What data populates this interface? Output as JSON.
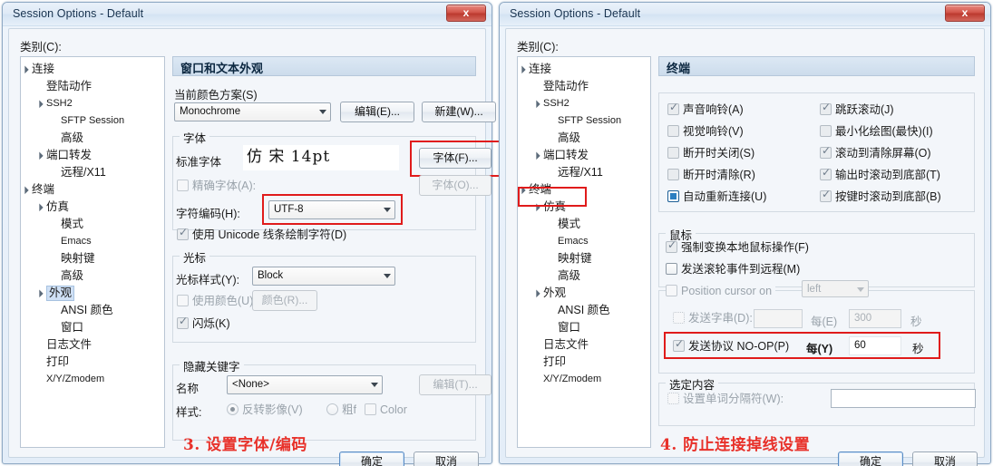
{
  "dialogs": {
    "left": {
      "title": "Session Options - Default",
      "close_label": "x",
      "category_label": "类别(C):",
      "pane_title": "窗口和文本外观",
      "tree": [
        {
          "label": "连接",
          "depth": 0,
          "arrow": "▲",
          "latin": false,
          "selected": false
        },
        {
          "label": "登陆动作",
          "depth": 1,
          "arrow": "",
          "latin": false,
          "selected": false
        },
        {
          "label": "SSH2",
          "depth": 1,
          "arrow": "▲",
          "latin": true,
          "selected": false
        },
        {
          "label": "SFTP Session",
          "depth": 2,
          "arrow": "",
          "latin": true,
          "selected": false
        },
        {
          "label": "高级",
          "depth": 2,
          "arrow": "",
          "latin": false,
          "selected": false
        },
        {
          "label": "端口转发",
          "depth": 1,
          "arrow": "▲",
          "latin": false,
          "selected": false
        },
        {
          "label": "远程/X11",
          "depth": 2,
          "arrow": "",
          "latin": false,
          "selected": false
        },
        {
          "label": "终端",
          "depth": 0,
          "arrow": "▲",
          "latin": false,
          "selected": false
        },
        {
          "label": "仿真",
          "depth": 1,
          "arrow": "▲",
          "latin": false,
          "selected": false
        },
        {
          "label": "模式",
          "depth": 2,
          "arrow": "",
          "latin": false,
          "selected": false
        },
        {
          "label": "Emacs",
          "depth": 2,
          "arrow": "",
          "latin": true,
          "selected": false
        },
        {
          "label": "映射键",
          "depth": 2,
          "arrow": "",
          "latin": false,
          "selected": false
        },
        {
          "label": "高级",
          "depth": 2,
          "arrow": "",
          "latin": false,
          "selected": false
        },
        {
          "label": "外观",
          "depth": 1,
          "arrow": "▲",
          "latin": false,
          "selected": true
        },
        {
          "label": "ANSI 颜色",
          "depth": 2,
          "arrow": "",
          "latin": false,
          "selected": false
        },
        {
          "label": "窗口",
          "depth": 2,
          "arrow": "",
          "latin": false,
          "selected": false
        },
        {
          "label": "日志文件",
          "depth": 1,
          "arrow": "",
          "latin": false,
          "selected": false
        },
        {
          "label": "打印",
          "depth": 1,
          "arrow": "",
          "latin": false,
          "selected": false
        },
        {
          "label": "X/Y/Zmodem",
          "depth": 1,
          "arrow": "",
          "latin": true,
          "selected": false
        }
      ],
      "color_scheme": {
        "group_label": "当前颜色方案(S)",
        "value": "Monochrome",
        "edit_button": "编辑(E)...",
        "new_button": "新建(W)..."
      },
      "font": {
        "group_label": "字体",
        "standard_font_label": "标准字体",
        "standard_font_value": "仿 宋  14pt",
        "font_button": "字体(F)...",
        "exact_font_label": "精确字体(A):",
        "exact_font_checked": false,
        "exact_font_button": "字体(O)...",
        "charset_label": "字符编码(H):",
        "charset_value": "UTF-8",
        "unicode_line_label": "使用 Unicode 线条绘制字符(D)",
        "unicode_line_checked": true
      },
      "cursor": {
        "group_label": "光标",
        "style_label": "光标样式(Y):",
        "style_value": "Block",
        "use_color_label": "使用颜色(U):",
        "use_color_checked": false,
        "color_button": "颜色(R)...",
        "blink_label": "闪烁(K)",
        "blink_checked": true
      },
      "hidden_keyword": {
        "group_label": "隐藏关键字",
        "name_label": "名称",
        "name_value": "<None>",
        "edit_button": "编辑(T)...",
        "style_label": "样式:",
        "radio_invert": "反转影像(V)",
        "radio_invert_selected": true,
        "radio_bold": "粗f",
        "radio_bold_selected": false,
        "color_checkbox": "Color",
        "color_checked": false
      },
      "annotation": "3. 设置字体/编码",
      "ok_button": "确定",
      "cancel_button": "取消"
    },
    "right": {
      "title": "Session Options - Default",
      "close_label": "x",
      "category_label": "类别(C):",
      "pane_title": "终端",
      "tree": [
        {
          "label": "连接",
          "depth": 0,
          "arrow": "▲",
          "latin": false,
          "selected": false
        },
        {
          "label": "登陆动作",
          "depth": 1,
          "arrow": "",
          "latin": false,
          "selected": false
        },
        {
          "label": "SSH2",
          "depth": 1,
          "arrow": "▲",
          "latin": true,
          "selected": false
        },
        {
          "label": "SFTP Session",
          "depth": 2,
          "arrow": "",
          "latin": true,
          "selected": false
        },
        {
          "label": "高级",
          "depth": 2,
          "arrow": "",
          "latin": false,
          "selected": false
        },
        {
          "label": "端口转发",
          "depth": 1,
          "arrow": "▲",
          "latin": false,
          "selected": false
        },
        {
          "label": "远程/X11",
          "depth": 2,
          "arrow": "",
          "latin": false,
          "selected": false
        },
        {
          "label": "终端",
          "depth": 0,
          "arrow": "▲",
          "latin": false,
          "selected": false
        },
        {
          "label": "仿真",
          "depth": 1,
          "arrow": "▲",
          "latin": false,
          "selected": false
        },
        {
          "label": "模式",
          "depth": 2,
          "arrow": "",
          "latin": false,
          "selected": false
        },
        {
          "label": "Emacs",
          "depth": 2,
          "arrow": "",
          "latin": true,
          "selected": false
        },
        {
          "label": "映射键",
          "depth": 2,
          "arrow": "",
          "latin": false,
          "selected": false
        },
        {
          "label": "高级",
          "depth": 2,
          "arrow": "",
          "latin": false,
          "selected": false
        },
        {
          "label": "外观",
          "depth": 1,
          "arrow": "▲",
          "latin": false,
          "selected": false
        },
        {
          "label": "ANSI 颜色",
          "depth": 2,
          "arrow": "",
          "latin": false,
          "selected": false
        },
        {
          "label": "窗口",
          "depth": 2,
          "arrow": "",
          "latin": false,
          "selected": false
        },
        {
          "label": "日志文件",
          "depth": 1,
          "arrow": "",
          "latin": false,
          "selected": false
        },
        {
          "label": "打印",
          "depth": 1,
          "arrow": "",
          "latin": false,
          "selected": false
        },
        {
          "label": "X/Y/Zmodem",
          "depth": 1,
          "arrow": "",
          "latin": true,
          "selected": false
        }
      ],
      "options_left": [
        {
          "label": "声音响铃(A)",
          "checked": true,
          "style": "gray"
        },
        {
          "label": "视觉响铃(V)",
          "checked": false,
          "style": "gray"
        },
        {
          "label": "断开时关闭(S)",
          "checked": false,
          "style": "gray"
        },
        {
          "label": "断开时清除(R)",
          "checked": false,
          "style": "gray"
        },
        {
          "label": "自动重新连接(U)",
          "checked": true,
          "style": "fill"
        }
      ],
      "options_right": [
        {
          "label": "跳跃滚动(J)",
          "checked": true,
          "style": "gray"
        },
        {
          "label": "最小化绘图(最快)(I)",
          "checked": false,
          "style": "gray"
        },
        {
          "label": "滚动到清除屏幕(O)",
          "checked": true,
          "style": "gray"
        },
        {
          "label": "输出时滚动到底部(T)",
          "checked": true,
          "style": "gray"
        },
        {
          "label": "按键时滚动到底部(B)",
          "checked": true,
          "style": "gray"
        }
      ],
      "mouse": {
        "group_label": "鼠标",
        "force_local_label": "强制变换本地鼠标操作(F)",
        "force_local_checked": true,
        "send_wheel_label": "发送滚轮事件到远程(M)",
        "send_wheel_checked": false
      },
      "keepalive": {
        "position_cursor_label": "Position cursor on",
        "position_cursor_checked": false,
        "position_cursor_value": "left",
        "send_string_label": "发送字串(D):",
        "send_string_checked": false,
        "send_string_value": "",
        "send_string_every_label": "每(E)",
        "send_string_interval": "300",
        "send_string_unit": "秒",
        "send_protocol_label": "发送协议  NO-OP(P)",
        "send_protocol_checked": true,
        "send_protocol_every_label": "每(Y)",
        "send_protocol_interval": "60",
        "send_protocol_unit": "秒"
      },
      "selection": {
        "group_label": "选定内容",
        "word_delim_label": "设置单词分隔符(W):",
        "word_delim_checked": false,
        "word_delim_value": ""
      },
      "annotation": "4. 防止连接掉线设置",
      "ok_button": "确定",
      "cancel_button": "取消"
    }
  },
  "colors": {
    "annotation_red": "#e8312a",
    "highlight_box_red": "#e01b1b",
    "titlebar_blue": "#d4e3f3",
    "pane_header_blue": "#ccdcec",
    "selection_blue": "#cfe0f5"
  }
}
